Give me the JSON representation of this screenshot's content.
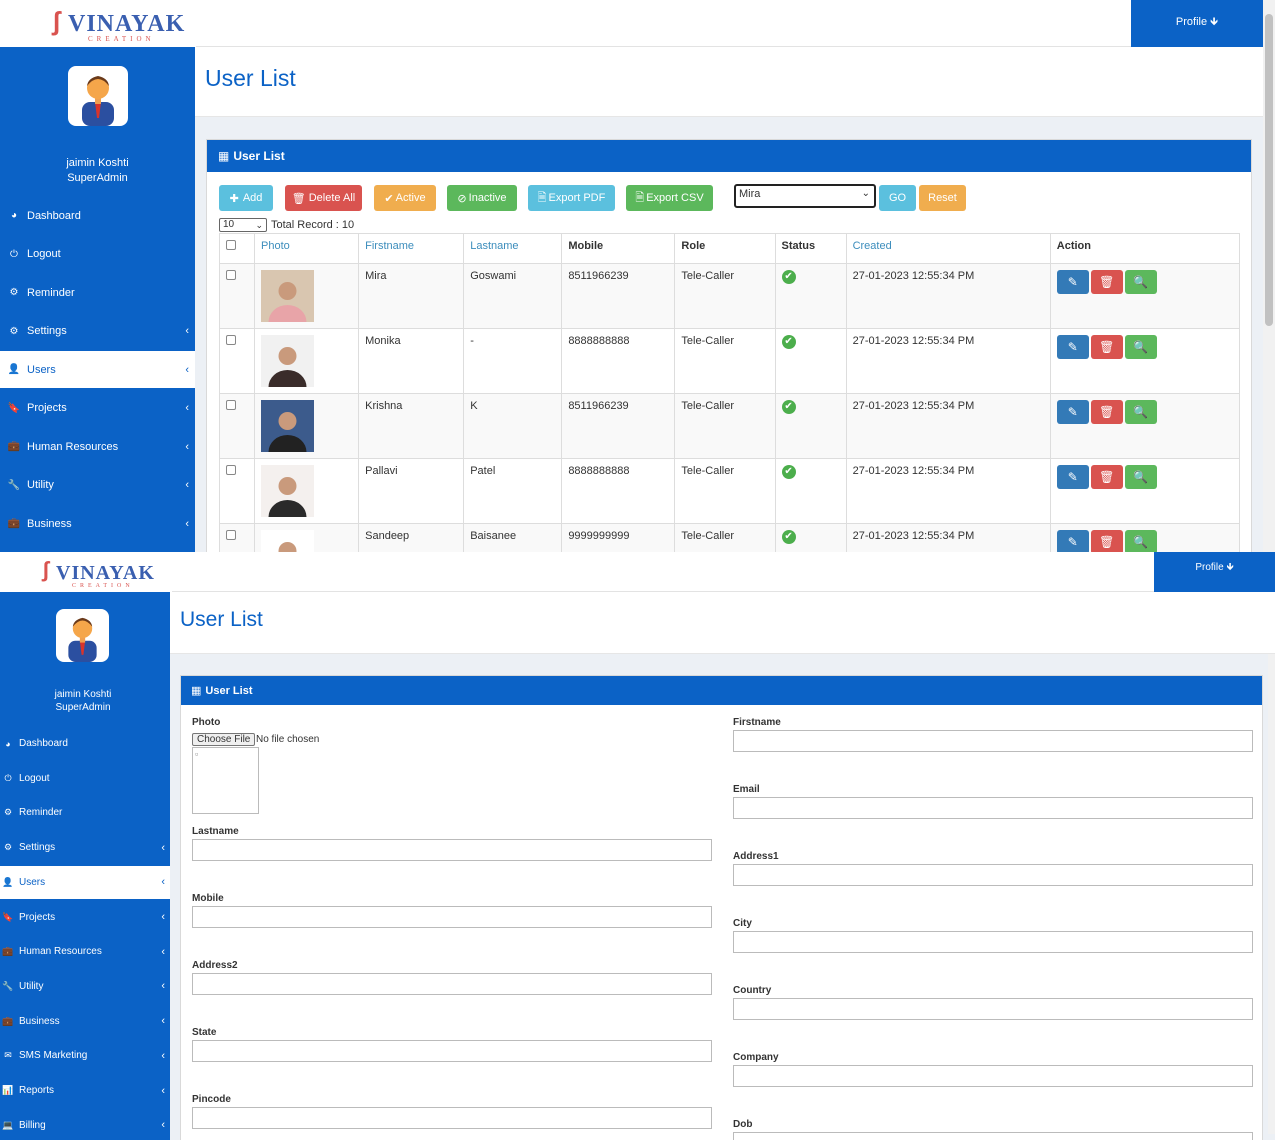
{
  "brand": {
    "name": "VINAYAK",
    "tagline": "CREATION"
  },
  "topbar": {
    "profile_label": "Profile 🡻"
  },
  "user": {
    "name": "jaimin Koshti",
    "role": "SuperAdmin"
  },
  "sidebar1": [
    {
      "label": "Dashboard",
      "icon": "dashboard-icon",
      "glyph": "◕",
      "chev": false,
      "active": false
    },
    {
      "label": "Logout",
      "icon": "power-icon",
      "glyph": "⏻",
      "chev": false,
      "active": false
    },
    {
      "label": "Reminder",
      "icon": "gear-icon",
      "glyph": "⚙",
      "chev": false,
      "active": false
    },
    {
      "label": "Settings",
      "icon": "cogs-icon",
      "glyph": "⚙",
      "chev": true,
      "active": false
    },
    {
      "label": "Users",
      "icon": "user-icon",
      "glyph": "👤",
      "chev": true,
      "active": true
    },
    {
      "label": "Projects",
      "icon": "bookmark-icon",
      "glyph": "🔖",
      "chev": true,
      "active": false
    },
    {
      "label": "Human Resources",
      "icon": "briefcase-icon",
      "glyph": "💼",
      "chev": true,
      "active": false
    },
    {
      "label": "Utility",
      "icon": "wrench-icon",
      "glyph": "🔧",
      "chev": true,
      "active": false
    },
    {
      "label": "Business",
      "icon": "briefcase-icon",
      "glyph": "💼",
      "chev": true,
      "active": false
    }
  ],
  "sidebar2": [
    {
      "label": "Dashboard",
      "icon": "dashboard-icon",
      "glyph": "◕",
      "chev": false,
      "active": false
    },
    {
      "label": "Logout",
      "icon": "power-icon",
      "glyph": "⏻",
      "chev": false,
      "active": false
    },
    {
      "label": "Reminder",
      "icon": "gear-icon",
      "glyph": "⚙",
      "chev": false,
      "active": false
    },
    {
      "label": "Settings",
      "icon": "cogs-icon",
      "glyph": "⚙",
      "chev": true,
      "active": false
    },
    {
      "label": "Users",
      "icon": "user-icon",
      "glyph": "👤",
      "chev": true,
      "active": true
    },
    {
      "label": "Projects",
      "icon": "bookmark-icon",
      "glyph": "🔖",
      "chev": true,
      "active": false
    },
    {
      "label": "Human Resources",
      "icon": "briefcase-icon",
      "glyph": "💼",
      "chev": true,
      "active": false
    },
    {
      "label": "Utility",
      "icon": "wrench-icon",
      "glyph": "🔧",
      "chev": true,
      "active": false
    },
    {
      "label": "Business",
      "icon": "briefcase-icon",
      "glyph": "💼",
      "chev": true,
      "active": false
    },
    {
      "label": "SMS Marketing",
      "icon": "envelope-icon",
      "glyph": "✉",
      "chev": true,
      "active": false
    },
    {
      "label": "Reports",
      "icon": "bar-chart-icon",
      "glyph": "📊",
      "chev": true,
      "active": false
    },
    {
      "label": "Billing",
      "icon": "laptop-icon",
      "glyph": "💻",
      "chev": true,
      "active": false
    }
  ],
  "page": {
    "title": "User List",
    "panel_title": "User List"
  },
  "toolbar": {
    "add": "Add",
    "delete_all": "Delete All",
    "active": "Active",
    "inactive": "Inactive",
    "export_pdf": "Export PDF",
    "export_csv": "Export CSV",
    "search_value": "Mira",
    "go": "GO",
    "reset": "Reset",
    "per_page": "10",
    "total_record": "Total Record : 10"
  },
  "table": {
    "headers": [
      "Photo",
      "Firstname",
      "Lastname",
      "Mobile",
      "Role",
      "Status",
      "Created",
      "Action"
    ],
    "rows": [
      {
        "first": "Mira",
        "last": "Goswami",
        "mobile": "8511966239",
        "role": "Tele-Caller",
        "created": "27-01-2023 12:55:34 PM",
        "photo": [
          "#d9c6b0",
          "#e8a4a8"
        ]
      },
      {
        "first": "Monika",
        "last": "-",
        "mobile": "8888888888",
        "role": "Tele-Caller",
        "created": "27-01-2023 12:55:34 PM",
        "photo": [
          "#f1f1f1",
          "#3a2c2a"
        ]
      },
      {
        "first": "Krishna",
        "last": "K",
        "mobile": "8511966239",
        "role": "Tele-Caller",
        "created": "27-01-2023 12:55:34 PM",
        "photo": [
          "#3c5b8c",
          "#222222"
        ]
      },
      {
        "first": "Pallavi",
        "last": "Patel",
        "mobile": "8888888888",
        "role": "Tele-Caller",
        "created": "27-01-2023 12:55:34 PM",
        "photo": [
          "#f4f0ee",
          "#2a2a2a"
        ]
      },
      {
        "first": "Sandeep",
        "last": "Baisanee",
        "mobile": "9999999999",
        "role": "Tele-Caller",
        "created": "27-01-2023 12:55:34 PM",
        "photo": [
          "#ffffff",
          "#3d3d3d"
        ]
      }
    ]
  },
  "form": {
    "photo_label": "Photo",
    "choose_file": "Choose File",
    "no_file": "No file chosen",
    "left": [
      "Lastname",
      "Mobile",
      "Address2",
      "State",
      "Pincode"
    ],
    "right": [
      "Firstname",
      "Email",
      "Address1",
      "City",
      "Country",
      "Company",
      "Dob"
    ]
  },
  "colors": {
    "primary": "#0b62c6",
    "link": "#3c8dbc"
  }
}
